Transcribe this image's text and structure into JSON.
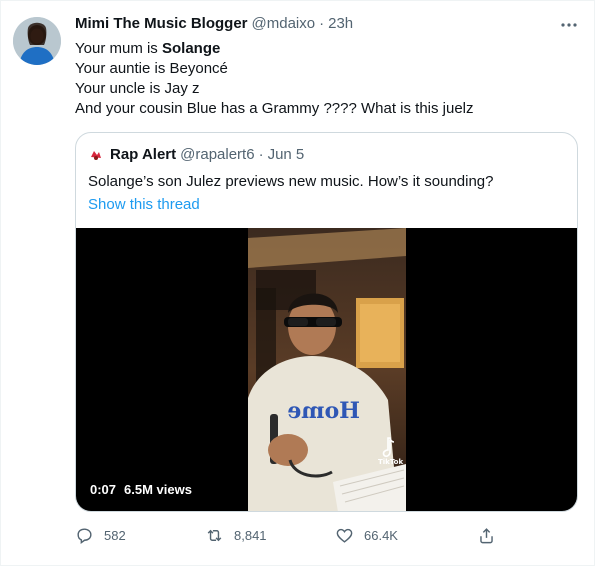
{
  "tweet": {
    "name": "Mimi The Music Blogger",
    "handle": "@mdaixo",
    "separator": "·",
    "time": "23h",
    "lines": [
      [
        "Your mum is ",
        "Solange"
      ],
      "Your auntie is Beyoncé",
      "Your uncle is Jay z",
      "And your cousin Blue has a Grammy ???? What is this juelz"
    ],
    "avatar_icon": "profile-photo",
    "more_icon": "ellipsis-icon"
  },
  "quote": {
    "name": "Rap Alert",
    "handle": "@rapalert6",
    "separator": "·",
    "date": "Jun 5",
    "text": "Solange’s son Julez previews new music. How’s it sounding?",
    "link": "Show this thread",
    "video": {
      "timestamp": "0:07",
      "views": "6.5M views",
      "watermark": "TikTok",
      "hoodie_text": "Home"
    }
  },
  "actions": {
    "reply_count": "582",
    "retweet_count": "8,841",
    "like_count": "66.4K"
  },
  "colors": {
    "accent": "#1d9bf0",
    "text": "#0f1419",
    "secondary": "#536471",
    "border": "#cfd9de"
  }
}
